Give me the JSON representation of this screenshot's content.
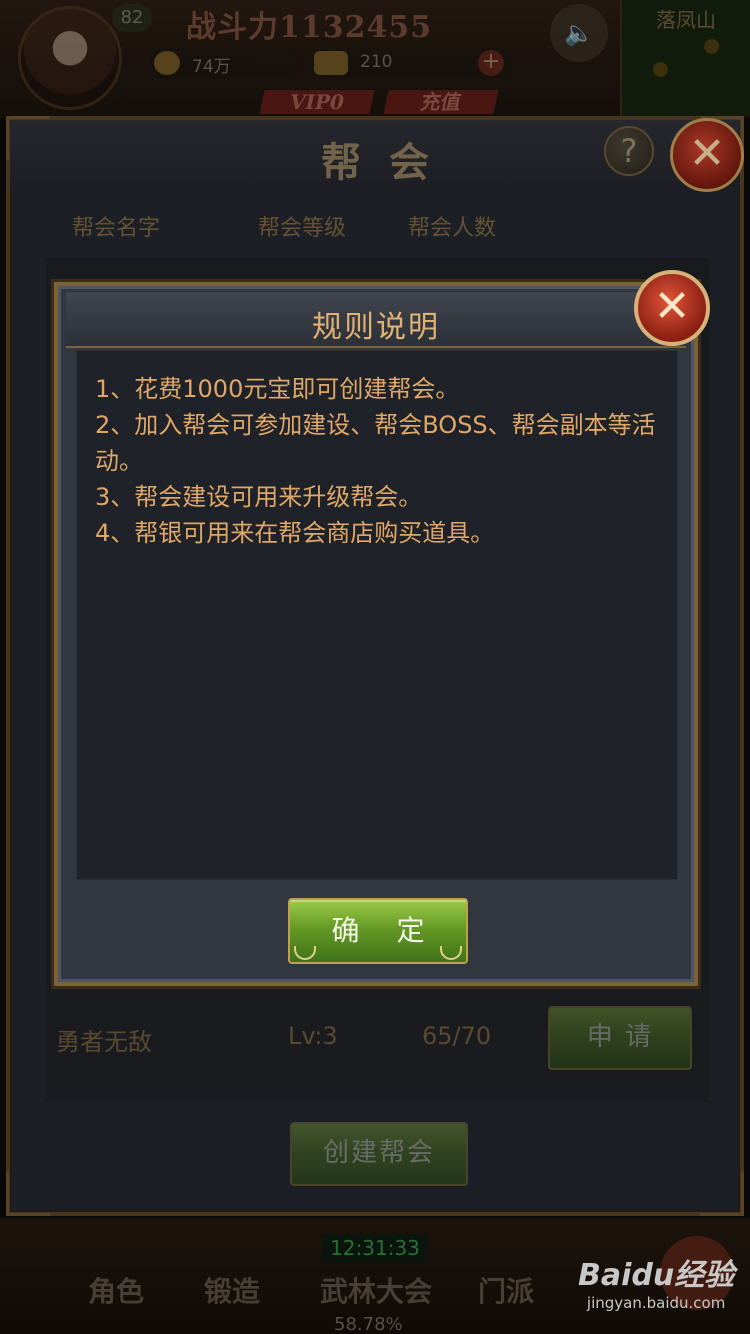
{
  "hud": {
    "player_level": "82",
    "combat_power": "战斗力1132455",
    "coins": "74万",
    "gold": "210",
    "plus_label": "+",
    "vip_label": "VIP0",
    "recharge_label": "充值",
    "sound_icon": "speaker-icon",
    "location": "落凤山",
    "server_time": "12:31:33",
    "progress_percent": "58.78%",
    "nav": {
      "role": "角色",
      "forge": "锻造",
      "tournament": "武林大会",
      "sect": "门派"
    }
  },
  "guild_panel": {
    "title": "帮会",
    "help_label": "?",
    "close_label": "✕",
    "columns": {
      "name": "帮会名字",
      "level": "帮会等级",
      "members": "帮会人数"
    },
    "rows": [
      {
        "name": "勇者无敌",
        "level": "Lv:3",
        "members": "65/70",
        "action": "申 请"
      }
    ],
    "create_button": "创建帮会"
  },
  "rules_dialog": {
    "title": "规则说明",
    "close_label": "✕",
    "rules": [
      "1、花费1000元宝即可创建帮会。",
      "2、加入帮会可参加建设、帮会BOSS、帮会副本等活动。",
      "3、帮会建设可用来升级帮会。",
      "4、帮银可用来在帮会商店购买道具。"
    ],
    "confirm_button": "确 定"
  },
  "watermark": {
    "brand": "Baidu经验",
    "domain": "jingyan.baidu.com"
  },
  "colors": {
    "accent_gold": "#e0a868",
    "button_green": "#659a26",
    "close_red": "#c0392b",
    "panel_bg": "#23272e"
  }
}
